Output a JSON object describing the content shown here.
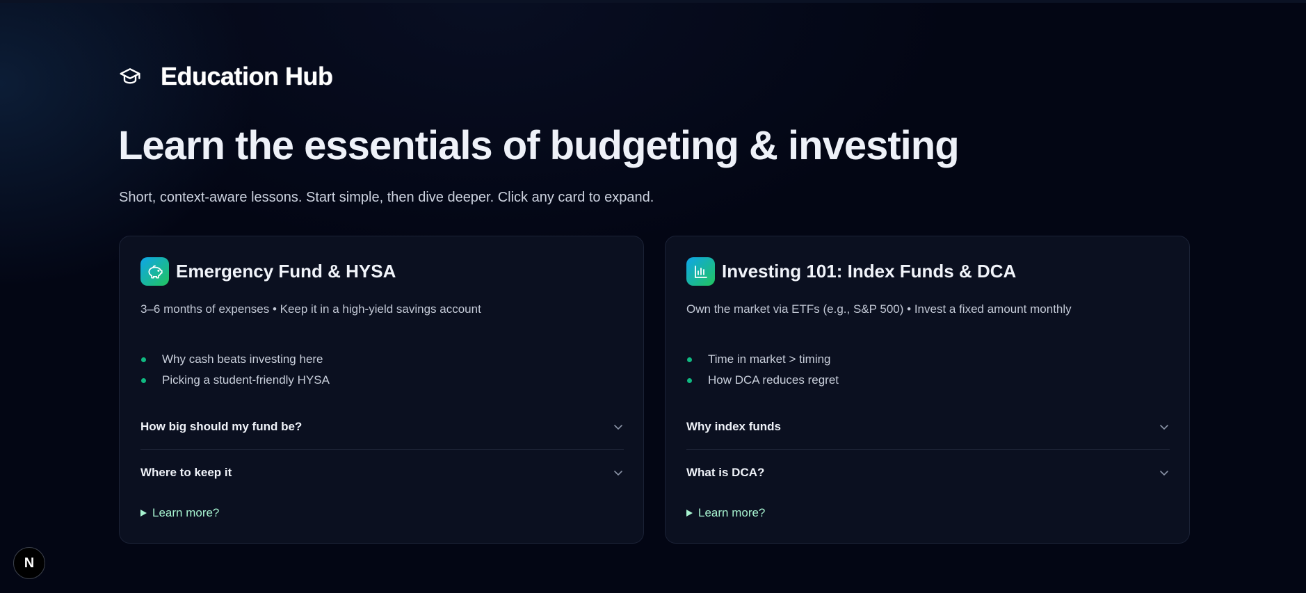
{
  "brand": {
    "title": "Education Hub",
    "icon": "graduation-cap-icon"
  },
  "hero": {
    "title": "Learn the essentials of budgeting & investing",
    "subtitle": "Short, context-aware lessons. Start simple, then dive deeper. Click any card to expand."
  },
  "colors": {
    "background": "#030614",
    "card": "#0b1020",
    "accent_green": "#10b981",
    "learn_more": "#a7f3d0"
  },
  "cards": [
    {
      "icon": "piggy-bank-icon",
      "title": "Emergency Fund & HYSA",
      "description": "3–6 months of expenses • Keep it in a high-yield savings account",
      "bullets": [
        "Why cash beats investing here",
        "Picking a student-friendly HYSA"
      ],
      "accordions": [
        "How big should my fund be?",
        "Where to keep it"
      ],
      "learn_more": "Learn more?"
    },
    {
      "icon": "bar-chart-icon",
      "title": "Investing 101: Index Funds & DCA",
      "description": "Own the market via ETFs (e.g., S&P 500) • Invest a fixed amount monthly",
      "bullets": [
        "Time in market > timing",
        "How DCA reduces regret"
      ],
      "accordions": [
        "Why index funds",
        "What is DCA?"
      ],
      "learn_more": "Learn more?"
    }
  ],
  "dev_badge": {
    "label": "N",
    "icon": "nextjs-logo-icon"
  }
}
